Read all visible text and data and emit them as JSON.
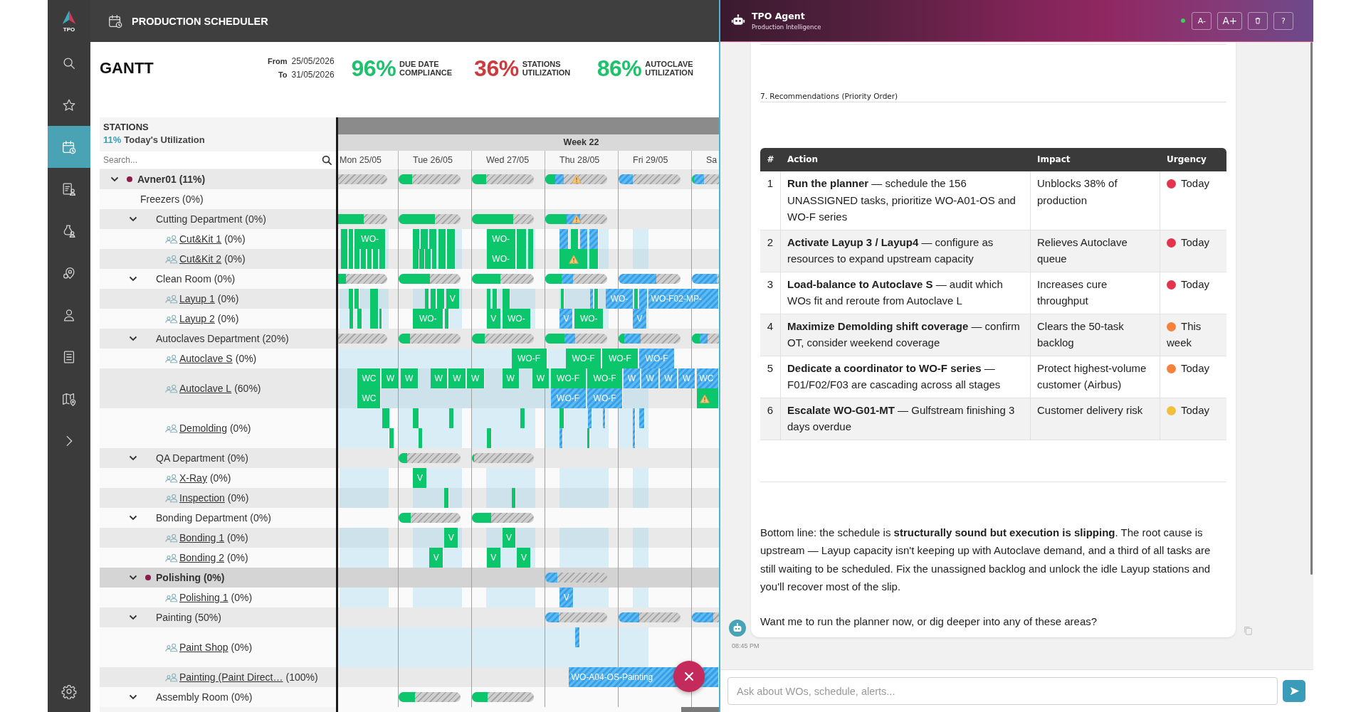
{
  "nav": {
    "logo_text": "TPO",
    "items": [
      {
        "kind": "search",
        "selected": false
      },
      {
        "kind": "favorites",
        "selected": false
      },
      {
        "kind": "scheduler",
        "selected": true
      },
      {
        "kind": "reports",
        "selected": false
      },
      {
        "kind": "inventory",
        "selected": false
      },
      {
        "kind": "locations",
        "selected": false
      },
      {
        "kind": "users",
        "selected": false
      },
      {
        "kind": "documents",
        "selected": false
      },
      {
        "kind": "maps",
        "selected": false
      },
      {
        "kind": "expand",
        "selected": false
      },
      {
        "kind": "settings",
        "selected": false
      }
    ]
  },
  "app_bar": {
    "title": "PRODUCTION SCHEDULER"
  },
  "header": {
    "title": "GANTT",
    "from_label": "From",
    "from": "25/05/2026",
    "to_label": "To",
    "to": "31/05/2026",
    "kpis": [
      {
        "value": "96%",
        "label": "DUE DATE COMPLIANCE",
        "color": "#1dc26b"
      },
      {
        "value": "36%",
        "label": "STATIONS UTILIZATION",
        "color": "#cf3a3e"
      },
      {
        "value": "86%",
        "label": "AUTOCLAVE UTILIZATION",
        "color": "#1dc26b"
      }
    ]
  },
  "stations_panel": {
    "title": "STATIONS",
    "utilization": "11%",
    "utilization_label": "Today's Utilization",
    "search": {
      "placeholder": "Search..."
    }
  },
  "gantt": {
    "week": "Week 22",
    "days": [
      "Mon 25/05",
      "Tue 26/05",
      "Wed 27/05",
      "Thu 28/05",
      "Fri 29/05",
      "Sa"
    ],
    "tree": [
      {
        "kind": "site",
        "label": "Avner01 (11%)",
        "flagged": true,
        "selected": false,
        "expanded": true,
        "days": [
          {
            "kind": "load",
            "alert": false
          },
          {
            "kind": "load",
            "alert": false,
            "segments": [
              {
                "kind": "scheduled",
                "level": 0.22
              }
            ]
          },
          {
            "kind": "load",
            "alert": false,
            "segments": [
              {
                "kind": "scheduled",
                "level": 0.23
              }
            ]
          },
          {
            "kind": "load",
            "alert": true,
            "segments": [
              {
                "kind": "scheduled",
                "level": 0.16
              },
              {
                "kind": "unassigned",
                "level": 0.3
              }
            ]
          },
          {
            "kind": "load",
            "alert": false,
            "segments": [
              {
                "kind": "unassigned",
                "level": 0.23
              }
            ]
          },
          {
            "kind": "load",
            "alert": false,
            "segments": [
              {
                "kind": "scheduled",
                "level": 0.07
              },
              {
                "kind": "unassigned",
                "level": 0.45
              }
            ]
          }
        ],
        "children": [
          {
            "kind": "department",
            "label": "Freezers (0%)",
            "flagged": false,
            "selected": false
          },
          {
            "kind": "department",
            "label": "Cutting Department (0%)",
            "flagged": false,
            "selected": false,
            "expanded": true,
            "days": [
              {
                "kind": "load",
                "alert": false,
                "segments": [
                  {
                    "kind": "scheduled",
                    "level": 0.52
                  }
                ]
              },
              {
                "kind": "load",
                "alert": false,
                "segments": [
                  {
                    "kind": "scheduled",
                    "level": 0.59
                  }
                ]
              },
              {
                "kind": "load",
                "alert": false,
                "segments": [
                  {
                    "kind": "scheduled",
                    "level": 0.67
                  }
                ]
              },
              {
                "kind": "load",
                "alert": true,
                "segments": [
                  {
                    "kind": "scheduled",
                    "level": 0.34
                  },
                  {
                    "kind": "unassigned",
                    "level": 0.56
                  }
                ]
              },
              {
                "kind": "none"
              },
              {
                "kind": "none"
              }
            ],
            "children": [
              {
                "kind": "station",
                "name": "Cut&Kit 1",
                "utilization": "(0%)",
                "flagged": false,
                "selected": false,
                "lanes": [
                  {
                    "kind": "day",
                    "bars": [
                      {
                        "kind": "scheduled",
                        "alert": false
                      },
                      {
                        "kind": "scheduled",
                        "alert": false
                      },
                      {
                        "kind": "scheduled",
                        "alert": false,
                        "label": "WO-"
                      },
                      {
                        "kind": "scheduled",
                        "alert": false
                      },
                      {
                        "kind": "scheduled",
                        "alert": false
                      },
                      {
                        "kind": "scheduled",
                        "alert": false
                      },
                      {
                        "kind": "scheduled",
                        "alert": false
                      },
                      {
                        "kind": "scheduled",
                        "alert": false
                      },
                      {
                        "kind": "scheduled",
                        "alert": false,
                        "label": "WO-"
                      },
                      {
                        "kind": "scheduled",
                        "alert": false
                      },
                      {
                        "kind": "scheduled",
                        "alert": false
                      },
                      {
                        "kind": "unassigned",
                        "alert": false
                      },
                      {
                        "kind": "scheduled",
                        "alert": false
                      },
                      {
                        "kind": "unassigned",
                        "alert": false
                      },
                      {
                        "kind": "unassigned",
                        "alert": false
                      }
                    ]
                  }
                ]
              },
              {
                "kind": "station",
                "name": "Cut&Kit 2",
                "utilization": "(0%)",
                "flagged": false,
                "selected": false,
                "lanes": [
                  {
                    "kind": "day",
                    "bars": [
                      {
                        "kind": "scheduled",
                        "alert": false
                      },
                      {
                        "kind": "scheduled",
                        "alert": false
                      },
                      {
                        "kind": "scheduled",
                        "alert": false
                      },
                      {
                        "kind": "scheduled",
                        "alert": false
                      },
                      {
                        "kind": "scheduled",
                        "alert": false
                      },
                      {
                        "kind": "scheduled",
                        "alert": false
                      },
                      {
                        "kind": "scheduled",
                        "alert": false
                      },
                      {
                        "kind": "scheduled",
                        "alert": false
                      },
                      {
                        "kind": "scheduled",
                        "alert": false
                      },
                      {
                        "kind": "scheduled",
                        "alert": false
                      },
                      {
                        "kind": "scheduled",
                        "alert": false
                      },
                      {
                        "kind": "scheduled",
                        "alert": false
                      },
                      {
                        "kind": "scheduled",
                        "alert": false
                      },
                      {
                        "kind": "scheduled",
                        "alert": false,
                        "label": "WO-"
                      },
                      {
                        "kind": "scheduled",
                        "alert": false
                      },
                      {
                        "kind": "scheduled",
                        "alert": false
                      },
                      {
                        "kind": "scheduled",
                        "alert": true
                      },
                      {
                        "kind": "scheduled",
                        "alert": false
                      }
                    ]
                  }
                ]
              }
            ]
          },
          {
            "kind": "department",
            "label": "Clean Room (0%)",
            "flagged": false,
            "selected": false,
            "expanded": true,
            "days": [
              {
                "kind": "load",
                "alert": false,
                "segments": [
                  {
                    "kind": "scheduled",
                    "level": 0.16
                  }
                ]
              },
              {
                "kind": "load",
                "alert": false,
                "segments": [
                  {
                    "kind": "scheduled",
                    "level": 0.5
                  }
                ]
              },
              {
                "kind": "load",
                "alert": false,
                "segments": [
                  {
                    "kind": "scheduled",
                    "level": 0.46
                  }
                ]
              },
              {
                "kind": "load",
                "alert": false,
                "segments": [
                  {
                    "kind": "scheduled",
                    "level": 0.27
                  },
                  {
                    "kind": "unassigned",
                    "level": 0.45
                  }
                ]
              },
              {
                "kind": "load",
                "alert": false,
                "segments": [
                  {
                    "kind": "unassigned",
                    "level": 0.61
                  }
                ]
              },
              {
                "kind": "load",
                "alert": false,
                "segments": [
                  {
                    "kind": "unassigned",
                    "level": 0.92
                  }
                ]
              }
            ],
            "children": [
              {
                "kind": "station",
                "name": "Layup 1",
                "utilization": "(0%)",
                "flagged": false,
                "selected": false,
                "lanes": [
                  {
                    "kind": "day",
                    "bars": [
                      {
                        "kind": "scheduled",
                        "alert": false
                      },
                      {
                        "kind": "scheduled",
                        "alert": false
                      },
                      {
                        "kind": "scheduled",
                        "alert": false
                      },
                      {
                        "kind": "scheduled",
                        "alert": false
                      },
                      {
                        "kind": "scheduled",
                        "alert": false
                      },
                      {
                        "kind": "scheduled",
                        "alert": false
                      },
                      {
                        "kind": "scheduled",
                        "alert": false,
                        "label": "V"
                      },
                      {
                        "kind": "scheduled",
                        "alert": false
                      },
                      {
                        "kind": "scheduled",
                        "alert": false
                      },
                      {
                        "kind": "scheduled",
                        "alert": false
                      },
                      {
                        "kind": "scheduled",
                        "alert": false
                      },
                      {
                        "kind": "unassigned",
                        "alert": false
                      },
                      {
                        "kind": "scheduled",
                        "alert": false
                      },
                      {
                        "kind": "unassigned",
                        "alert": false,
                        "label": "WO-"
                      },
                      {
                        "kind": "scheduled",
                        "alert": false
                      },
                      {
                        "kind": "unassigned",
                        "alert": false
                      },
                      {
                        "kind": "unassigned",
                        "alert": false,
                        "label": "WO-F02-MP-"
                      }
                    ]
                  }
                ]
              },
              {
                "kind": "station",
                "name": "Layup 2",
                "utilization": "(0%)",
                "flagged": false,
                "selected": false,
                "lanes": [
                  {
                    "kind": "day",
                    "bars": [
                      {
                        "kind": "scheduled",
                        "alert": false
                      },
                      {
                        "kind": "scheduled",
                        "alert": false
                      },
                      {
                        "kind": "scheduled",
                        "alert": false
                      },
                      {
                        "kind": "scheduled",
                        "alert": false
                      },
                      {
                        "kind": "scheduled",
                        "alert": false,
                        "label": "WO-"
                      },
                      {
                        "kind": "scheduled",
                        "alert": false
                      },
                      {
                        "kind": "scheduled",
                        "alert": false,
                        "label": "V"
                      },
                      {
                        "kind": "scheduled",
                        "alert": false,
                        "label": "WO-"
                      },
                      {
                        "kind": "unassigned",
                        "alert": false,
                        "label": "V"
                      },
                      {
                        "kind": "scheduled",
                        "alert": false,
                        "label": "WO-"
                      },
                      {
                        "kind": "unassigned",
                        "alert": false,
                        "label": "V"
                      }
                    ]
                  }
                ]
              }
            ]
          },
          {
            "kind": "department",
            "label": "Autoclaves Department (20%)",
            "flagged": false,
            "selected": false,
            "expanded": true,
            "days": [
              {
                "kind": "load",
                "alert": false
              },
              {
                "kind": "load",
                "alert": false,
                "segments": [
                  {
                    "kind": "scheduled",
                    "level": 0.18
                  }
                ]
              },
              {
                "kind": "load",
                "alert": false,
                "segments": [
                  {
                    "kind": "scheduled",
                    "level": 0.21
                  }
                ]
              },
              {
                "kind": "load",
                "alert": false,
                "segments": [
                  {
                    "kind": "scheduled",
                    "level": 0.31
                  },
                  {
                    "kind": "unassigned",
                    "level": 0.48
                  }
                ]
              },
              {
                "kind": "load",
                "alert": false,
                "segments": [
                  {
                    "kind": "scheduled",
                    "level": 0.09
                  },
                  {
                    "kind": "unassigned",
                    "level": 0.36
                  }
                ]
              },
              {
                "kind": "load",
                "alert": false,
                "segments": [
                  {
                    "kind": "scheduled",
                    "level": 0.29
                  },
                  {
                    "kind": "unassigned",
                    "level": 0.59
                  }
                ]
              }
            ],
            "children": [
              {
                "kind": "station",
                "name": "Autoclave S",
                "utilization": "(0%)",
                "flagged": false,
                "selected": false,
                "lanes": [
                  {
                    "kind": "continuous",
                    "bars": [
                      {
                        "kind": "scheduled",
                        "alert": false,
                        "label": "WO-F"
                      },
                      {
                        "kind": "scheduled",
                        "alert": false,
                        "label": "WO-F"
                      },
                      {
                        "kind": "scheduled",
                        "alert": false,
                        "label": "WO-F"
                      },
                      {
                        "kind": "unassigned",
                        "alert": false,
                        "label": "WO-F"
                      }
                    ]
                  }
                ]
              },
              {
                "kind": "station",
                "name": "Autoclave L",
                "utilization": "(60%)",
                "flagged": false,
                "selected": false,
                "lanes": [
                  {
                    "kind": "continuous",
                    "bars": [
                      {
                        "kind": "scheduled",
                        "alert": false,
                        "label": "WC"
                      },
                      {
                        "kind": "scheduled",
                        "alert": false,
                        "label": "W"
                      },
                      {
                        "kind": "scheduled",
                        "alert": false,
                        "label": "W"
                      },
                      {
                        "kind": "scheduled",
                        "alert": false,
                        "label": "W"
                      },
                      {
                        "kind": "scheduled",
                        "alert": false,
                        "label": "W"
                      },
                      {
                        "kind": "scheduled",
                        "alert": false,
                        "label": "W"
                      },
                      {
                        "kind": "scheduled",
                        "alert": false,
                        "label": "W"
                      },
                      {
                        "kind": "scheduled",
                        "alert": false,
                        "label": "W"
                      },
                      {
                        "kind": "scheduled",
                        "alert": false,
                        "label": "WO-F"
                      },
                      {
                        "kind": "scheduled",
                        "alert": false,
                        "label": "WO-F"
                      },
                      {
                        "kind": "unassigned",
                        "alert": false,
                        "label": "W"
                      },
                      {
                        "kind": "unassigned",
                        "alert": false,
                        "label": "W"
                      },
                      {
                        "kind": "unassigned",
                        "alert": false,
                        "label": "W"
                      },
                      {
                        "kind": "unassigned",
                        "alert": false,
                        "label": "W"
                      },
                      {
                        "kind": "unassigned",
                        "alert": false,
                        "label": "WC"
                      }
                    ]
                  },
                  {
                    "kind": "continuous",
                    "bars": [
                      {
                        "kind": "scheduled",
                        "alert": false,
                        "label": "WC"
                      },
                      {
                        "kind": "unassigned",
                        "alert": false,
                        "label": "WO-F"
                      },
                      {
                        "kind": "unassigned",
                        "alert": false,
                        "label": "WO-F"
                      },
                      {
                        "kind": "scheduled",
                        "alert": true
                      }
                    ]
                  }
                ]
              },
              {
                "kind": "station",
                "name": "Demolding",
                "utilization": "(0%)",
                "flagged": false,
                "selected": false,
                "lanes": [
                  {
                    "kind": "extended",
                    "bars": [
                      {
                        "kind": "scheduled",
                        "alert": false
                      },
                      {
                        "kind": "scheduled",
                        "alert": false
                      },
                      {
                        "kind": "scheduled",
                        "alert": false
                      },
                      {
                        "kind": "scheduled",
                        "alert": false
                      },
                      {
                        "kind": "scheduled",
                        "alert": false
                      },
                      {
                        "kind": "unassigned",
                        "alert": false
                      },
                      {
                        "kind": "unassigned",
                        "alert": false
                      },
                      {
                        "kind": "unassigned",
                        "alert": false
                      },
                      {
                        "kind": "unassigned",
                        "alert": false
                      }
                    ]
                  },
                  {
                    "kind": "extended",
                    "bars": [
                      {
                        "kind": "scheduled",
                        "alert": false
                      },
                      {
                        "kind": "scheduled",
                        "alert": false
                      },
                      {
                        "kind": "scheduled",
                        "alert": false
                      },
                      {
                        "kind": "unassigned",
                        "alert": false
                      },
                      {
                        "kind": "scheduled",
                        "alert": false
                      },
                      {
                        "kind": "unassigned",
                        "alert": false
                      }
                    ]
                  }
                ]
              }
            ]
          },
          {
            "kind": "department",
            "label": "QA Department (0%)",
            "flagged": false,
            "selected": false,
            "expanded": true,
            "days": [
              {
                "kind": "none"
              },
              {
                "kind": "load",
                "alert": false,
                "segments": [
                  {
                    "kind": "scheduled",
                    "level": 0.14
                  }
                ]
              },
              {
                "kind": "load",
                "alert": false,
                "segments": [
                  {
                    "kind": "scheduled",
                    "level": 0.04
                  }
                ]
              },
              {
                "kind": "none"
              },
              {
                "kind": "none"
              },
              {
                "kind": "none"
              }
            ],
            "children": [
              {
                "kind": "station",
                "name": "X-Ray",
                "utilization": "(0%)",
                "flagged": false,
                "selected": false,
                "lanes": [
                  {
                    "kind": "day",
                    "bars": [
                      {
                        "kind": "scheduled",
                        "alert": false,
                        "label": "V"
                      }
                    ]
                  }
                ]
              },
              {
                "kind": "station",
                "name": "Inspection",
                "utilization": "(0%)",
                "flagged": false,
                "selected": false,
                "lanes": [
                  {
                    "kind": "day",
                    "bars": [
                      {
                        "kind": "scheduled",
                        "alert": false
                      },
                      {
                        "kind": "scheduled",
                        "alert": false
                      }
                    ]
                  }
                ]
              }
            ]
          },
          {
            "kind": "department",
            "label": "Bonding Department (0%)",
            "flagged": false,
            "selected": false,
            "expanded": true,
            "days": [
              {
                "kind": "none"
              },
              {
                "kind": "load",
                "alert": false,
                "segments": [
                  {
                    "kind": "scheduled",
                    "level": 0.2
                  }
                ]
              },
              {
                "kind": "load",
                "alert": false,
                "segments": [
                  {
                    "kind": "scheduled",
                    "level": 0.31
                  }
                ]
              },
              {
                "kind": "none"
              },
              {
                "kind": "none"
              },
              {
                "kind": "none"
              }
            ],
            "children": [
              {
                "kind": "station",
                "name": "Bonding 1",
                "utilization": "(0%)",
                "flagged": false,
                "selected": false,
                "lanes": [
                  {
                    "kind": "day",
                    "bars": [
                      {
                        "kind": "scheduled",
                        "alert": false,
                        "label": "V"
                      },
                      {
                        "kind": "scheduled",
                        "alert": false,
                        "label": "V"
                      }
                    ]
                  }
                ]
              },
              {
                "kind": "station",
                "name": "Bonding 2",
                "utilization": "(0%)",
                "flagged": false,
                "selected": false,
                "lanes": [
                  {
                    "kind": "day",
                    "bars": [
                      {
                        "kind": "scheduled",
                        "alert": false,
                        "label": "V"
                      },
                      {
                        "kind": "scheduled",
                        "alert": false,
                        "label": "V"
                      },
                      {
                        "kind": "scheduled",
                        "alert": false,
                        "label": "V"
                      }
                    ]
                  }
                ]
              }
            ]
          },
          {
            "kind": "department",
            "label": "Polishing (0%)",
            "flagged": true,
            "selected": true,
            "expanded": true,
            "days": [
              {
                "kind": "none"
              },
              {
                "kind": "none"
              },
              {
                "kind": "none"
              },
              {
                "kind": "load",
                "alert": false,
                "segments": [
                  {
                    "kind": "unassigned",
                    "level": 0.2
                  }
                ]
              },
              {
                "kind": "none"
              },
              {
                "kind": "none"
              }
            ],
            "children": [
              {
                "kind": "station",
                "name": "Polishing 1",
                "utilization": "(0%)",
                "flagged": false,
                "selected": false,
                "lanes": [
                  {
                    "kind": "day",
                    "bars": [
                      {
                        "kind": "unassigned",
                        "alert": false,
                        "label": "V"
                      }
                    ]
                  }
                ]
              }
            ]
          },
          {
            "kind": "department",
            "label": "Painting (50%)",
            "flagged": false,
            "selected": false,
            "expanded": true,
            "days": [
              {
                "kind": "none"
              },
              {
                "kind": "none"
              },
              {
                "kind": "none"
              },
              {
                "kind": "load",
                "alert": false,
                "segments": [
                  {
                    "kind": "unassigned",
                    "level": 0.22
                  }
                ]
              },
              {
                "kind": "load",
                "alert": false,
                "segments": [
                  {
                    "kind": "unassigned",
                    "level": 0.33
                  }
                ]
              },
              {
                "kind": "load",
                "alert": false,
                "segments": [
                  {
                    "kind": "unassigned",
                    "level": 0.78
                  }
                ]
              }
            ],
            "children": [
              {
                "kind": "station",
                "name": "Paint Shop",
                "utilization": "(0%)",
                "flagged": false,
                "selected": false,
                "lanes": [
                  {
                    "kind": "continuous",
                    "bars": [
                      {
                        "kind": "unassigned",
                        "alert": false
                      }
                    ]
                  },
                  {
                    "kind": "continuous"
                  }
                ]
              },
              {
                "kind": "station",
                "name": "Painting (Paint Direct…",
                "utilization": "(100%)",
                "flagged": false,
                "selected": false,
                "lanes": [
                  {
                    "kind": "plain",
                    "bars": [
                      {
                        "kind": "unassigned",
                        "alert": false,
                        "label": "WO-A04-OS-Painting"
                      }
                    ]
                  }
                ]
              }
            ]
          },
          {
            "kind": "department",
            "label": "Assembly Room (0%)",
            "flagged": false,
            "selected": false,
            "expanded": true,
            "days": [
              {
                "kind": "none"
              },
              {
                "kind": "load",
                "alert": false,
                "segments": [
                  {
                    "kind": "scheduled",
                    "level": 0.27
                  }
                ]
              },
              {
                "kind": "load",
                "alert": false,
                "segments": [
                  {
                    "kind": "scheduled",
                    "level": 0.25
                  }
                ]
              },
              {
                "kind": "none"
              },
              {
                "kind": "none"
              },
              {
                "kind": "none"
              }
            ]
          }
        ]
      }
    ]
  },
  "floating_button": {
    "kind": "close"
  },
  "chat": {
    "title": "TPO Agent",
    "subtitle": "Production Intelligence",
    "online": true,
    "controls": [
      {
        "kind": "decrease",
        "label": "A-"
      },
      {
        "kind": "increase",
        "label": "A+"
      },
      {
        "kind": "delete"
      },
      {
        "kind": "help",
        "label": "?"
      }
    ],
    "message": {
      "section_title": "7. Recommendations (Priority Order)",
      "table": {
        "columns": [
          "#",
          "Action",
          "Impact",
          "Urgency"
        ],
        "rows": [
          {
            "number": "1",
            "action": "**Run the planner** — schedule the 156 UNASSIGNED tasks, prioritize WO-A01-OS and WO-F series",
            "impact": "Unblocks 38% of production",
            "urgency": "Today",
            "color": "#e5334b"
          },
          {
            "number": "2",
            "action": "**Activate Layup 3 / Layup4** — configure as resources to expand upstream capacity",
            "impact": "Relieves Autoclave queue",
            "urgency": "Today",
            "color": "#e5334b"
          },
          {
            "number": "3",
            "action": "**Load-balance to Autoclave S** — audit which WOs fit and reroute from Autoclave L",
            "impact": "Increases cure throughput",
            "urgency": "Today",
            "color": "#e5334b"
          },
          {
            "number": "4",
            "action": "**Maximize Demolding shift coverage** — confirm OT, consider weekend coverage",
            "impact": "Clears the 50-task backlog",
            "urgency": "This week",
            "color": "#f5813a"
          },
          {
            "number": "5",
            "action": "**Dedicate a coordinator to WO-F series** — F01/F02/F03 are cascading across all stages",
            "impact": "Protect highest-volume customer (Airbus)",
            "urgency": "Today",
            "color": "#f5813a"
          },
          {
            "number": "6",
            "action": "**Escalate WO-G01-MT** — Gulfstream finishing 3 days overdue",
            "impact": "Customer delivery risk",
            "urgency": "Today",
            "color": "#f0c03c"
          }
        ]
      },
      "paragraphs": [
        "Bottom line: the schedule is **structurally sound but execution is slipping**. The root cause is upstream — Layup capacity isn't keeping up with Autoclave demand, and a third of all tasks are still waiting to be scheduled. Fix the unassigned backlog and unlock the idle Layup stations and you'll recover most of the slip.",
        "Want me to run the planner now, or dig deeper into any of these areas?"
      ],
      "time": "08:45 PM"
    },
    "input": {
      "placeholder": "Ask about WOs, schedule, alerts..."
    }
  }
}
